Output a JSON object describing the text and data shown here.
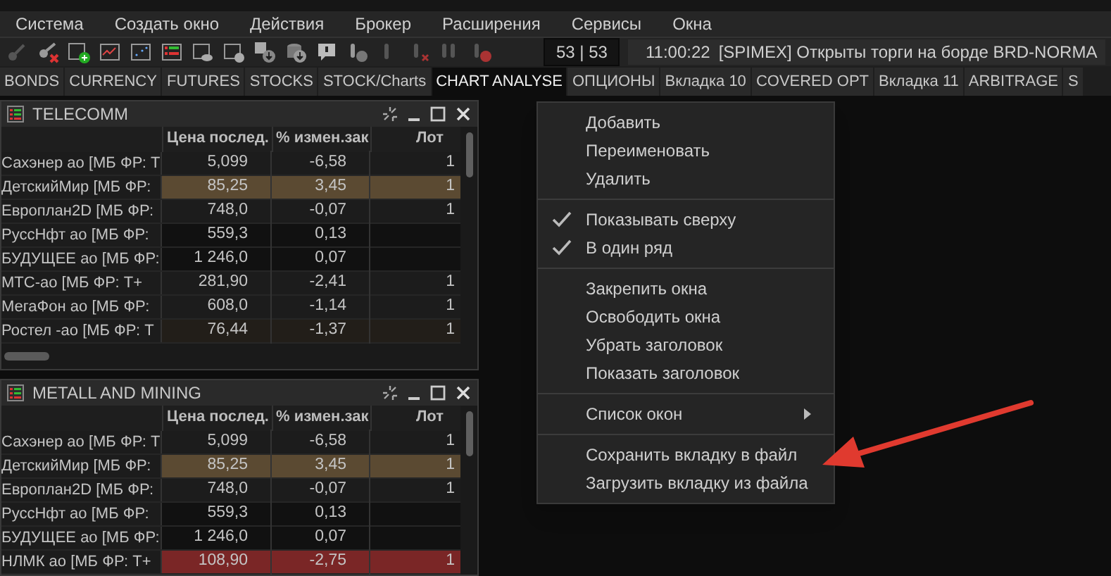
{
  "menu_bar": [
    "Система",
    "Создать окно",
    "Действия",
    "Брокер",
    "Расширения",
    "Сервисы",
    "Окна"
  ],
  "toolbar": {
    "counter": "53 | 53",
    "time": "11:00:22",
    "message": "[SPIMEX] Открыты торги на борде BRD-NORMA"
  },
  "tabs": [
    {
      "label": "BONDS",
      "selected": false
    },
    {
      "label": "CURRENCY",
      "selected": false
    },
    {
      "label": "FUTURES",
      "selected": false
    },
    {
      "label": "STOCKS",
      "selected": false
    },
    {
      "label": "STOCK/Charts",
      "selected": false
    },
    {
      "label": "CHART ANALYSE",
      "selected": true
    },
    {
      "label": "ОПЦИОНЫ",
      "selected": false
    },
    {
      "label": "Вкладка 10",
      "selected": false
    },
    {
      "label": "COVERED OPT",
      "selected": false
    },
    {
      "label": "Вкладка 11",
      "selected": false
    },
    {
      "label": "ARBITRAGE",
      "selected": false
    },
    {
      "label": "S",
      "selected": false
    }
  ],
  "windows": [
    {
      "title": "TELECOMM",
      "columns": [
        "Цена послед.",
        "% измен.зак",
        "Лот"
      ],
      "horizontal_scroll": true,
      "rows": [
        {
          "name": "Сахэнер ао [МБ ФР: Т",
          "price": "5,099",
          "change": "-6,58",
          "lot": "1",
          "kind": "normal"
        },
        {
          "name": "ДетскийМир [МБ ФР:",
          "price": "85,25",
          "change": "3,45",
          "lot": "1",
          "kind": "up"
        },
        {
          "name": "Европлан2D [МБ ФР:",
          "price": "748,0",
          "change": "-0,07",
          "lot": "1",
          "kind": "normal"
        },
        {
          "name": "РуссНфт ао [МБ ФР:",
          "price": "559,3",
          "change": "0,13",
          "kind": "dark"
        },
        {
          "name": "БУДУЩЕЕ ао [МБ ФР:",
          "price": "1 246,0",
          "change": "0,07",
          "kind": "dark"
        },
        {
          "name": "МТС-ао [МБ ФР: Т+",
          "price": "281,90",
          "change": "-2,41",
          "lot": "1",
          "kind": "normal"
        },
        {
          "name": "МегаФон ао [МБ ФР:",
          "price": "608,0",
          "change": "-1,14",
          "lot": "1",
          "kind": "normal"
        },
        {
          "name": "Ростел -ао [МБ ФР: Т",
          "price": "76,44",
          "change": "-1,37",
          "lot": "1",
          "kind": "warm"
        }
      ]
    },
    {
      "title": "METALL AND MINING",
      "columns": [
        "Цена послед.",
        "% измен.зак",
        "Лот"
      ],
      "horizontal_scroll": false,
      "rows": [
        {
          "name": "Сахэнер ао [МБ ФР: Т",
          "price": "5,099",
          "change": "-6,58",
          "lot": "1",
          "kind": "normal"
        },
        {
          "name": "ДетскийМир [МБ ФР:",
          "price": "85,25",
          "change": "3,45",
          "lot": "1",
          "kind": "up"
        },
        {
          "name": "Европлан2D [МБ ФР:",
          "price": "748,0",
          "change": "-0,07",
          "lot": "1",
          "kind": "normal"
        },
        {
          "name": "РуссНфт ао [МБ ФР:",
          "price": "559,3",
          "change": "0,13",
          "kind": "dark"
        },
        {
          "name": "БУДУЩЕЕ ао [МБ ФР:",
          "price": "1 246,0",
          "change": "0,07",
          "kind": "dark"
        },
        {
          "name": "НЛМК ао [МБ ФР: Т+",
          "price": "108,90",
          "change": "-2,75",
          "lot": "1",
          "kind": "down"
        }
      ]
    }
  ],
  "context_menu": [
    [
      {
        "label": "Добавить",
        "kind": "item"
      },
      {
        "label": "Переименовать",
        "kind": "item"
      },
      {
        "label": "Удалить",
        "kind": "item"
      }
    ],
    [
      {
        "label": "Показывать сверху",
        "kind": "check",
        "checked": true
      },
      {
        "label": "В один ряд",
        "kind": "check",
        "checked": true
      }
    ],
    [
      {
        "label": "Закрепить окна",
        "kind": "item"
      },
      {
        "label": "Освободить окна",
        "kind": "item"
      },
      {
        "label": "Убрать заголовок",
        "kind": "item"
      },
      {
        "label": "Показать заголовок",
        "kind": "item"
      }
    ],
    [
      {
        "label": "Список окон",
        "kind": "submenu"
      }
    ],
    [
      {
        "label": "Сохранить вкладку в файл",
        "kind": "item"
      },
      {
        "label": "Загрузить вкладку из файла",
        "kind": "item"
      }
    ]
  ]
}
